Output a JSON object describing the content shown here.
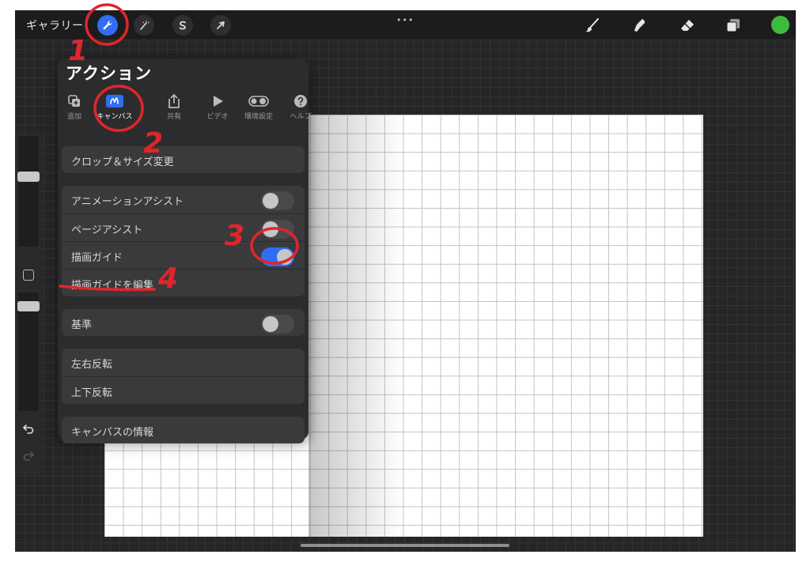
{
  "topbar": {
    "gallery_label": "ギャラリー",
    "more_dots": "•••",
    "color_dot": "#3dbb3c",
    "left_tools": [
      "wrench-icon",
      "magic-wand-icon",
      "selection-icon",
      "move-arrow-icon"
    ],
    "right_tools": [
      "brush-icon",
      "smudge-icon",
      "eraser-icon",
      "layers-icon"
    ]
  },
  "actions_panel": {
    "title": "アクション",
    "tabs": [
      {
        "label": "追加",
        "icon": "add-icon"
      },
      {
        "label": "キャンバス",
        "icon": "canvas-icon",
        "active": true
      },
      {
        "label": "共有",
        "icon": "share-icon"
      },
      {
        "label": "ビデオ",
        "icon": "video-play-icon"
      },
      {
        "label": "環境設定",
        "icon": "preferences-toggle-icon"
      },
      {
        "label": "ヘルプ",
        "icon": "help-icon"
      }
    ],
    "crop_resize": "クロップ＆サイズ変更",
    "animation_assist": {
      "label": "アニメーションアシスト",
      "on": false
    },
    "page_assist": {
      "label": "ページアシスト",
      "on": false
    },
    "drawing_guide": {
      "label": "描画ガイド",
      "on": true
    },
    "edit_drawing_guide": "描画ガイドを編集",
    "reference": {
      "label": "基準",
      "on": false
    },
    "flip_horizontal": "左右反転",
    "flip_vertical": "上下反転",
    "canvas_info": "キャンバスの情報"
  },
  "annotations": {
    "step1": "1",
    "step2": "2",
    "step3": "3",
    "step4": "4",
    "color": "#e0262b"
  },
  "colors": {
    "accent": "#2f6ef5",
    "panel_bg": "#2c2c2e",
    "row_bg": "#3a3a3c",
    "workspace": "#262628"
  }
}
